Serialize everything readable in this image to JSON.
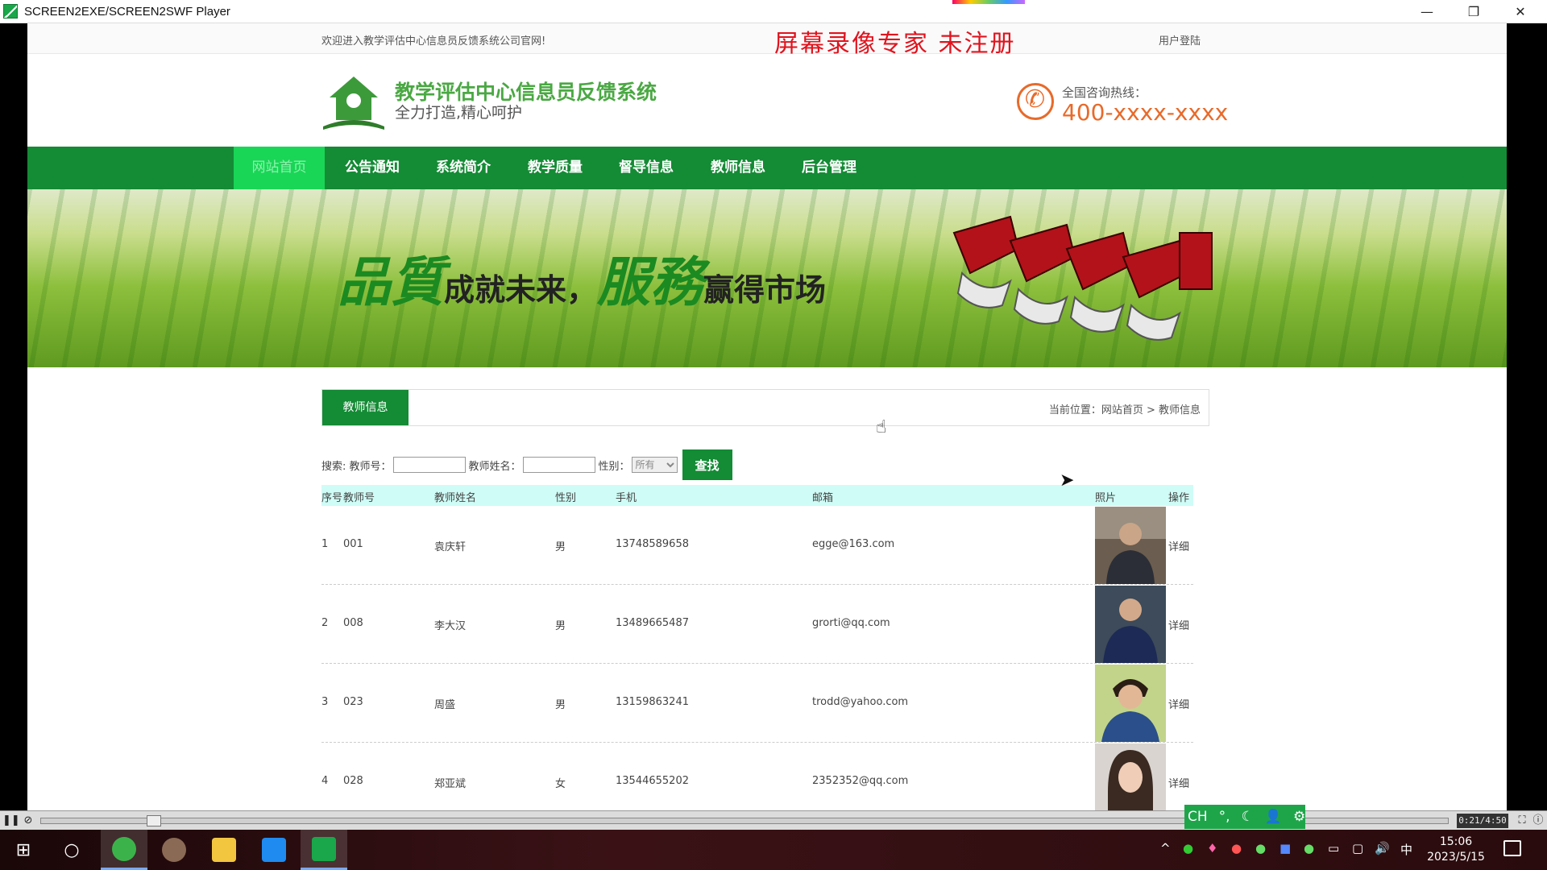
{
  "window": {
    "title": "SCREEN2EXE/SCREEN2SWF Player",
    "min_glyph": "—",
    "max_glyph": "❐",
    "close_glyph": "✕"
  },
  "watermark": "屏幕录像专家  未注册",
  "topbar": {
    "welcome": "欢迎进入教学评估中心信息员反馈系统公司官网!",
    "login": "用户登陆"
  },
  "header": {
    "title": "教学评估中心信息员反馈系统",
    "slogan": "全力打造,精心呵护",
    "hotline_label": "全国咨询热线：",
    "hotline_number": "400-xxxx-xxxx"
  },
  "nav": {
    "items": [
      {
        "label": "网站首页",
        "active": true
      },
      {
        "label": "公告通知"
      },
      {
        "label": "系统简介"
      },
      {
        "label": "教学质量"
      },
      {
        "label": "督导信息"
      },
      {
        "label": "教师信息"
      },
      {
        "label": "后台管理"
      }
    ]
  },
  "banner": {
    "big1": "品質",
    "mid1": "成就未来，",
    "big2": "服務",
    "mid2": "赢得市场"
  },
  "section": {
    "tab": "教师信息",
    "breadcrumb": "当前位置：网站首页 > 教师信息"
  },
  "search": {
    "label": "搜索: 教师号：",
    "name_label": "教师姓名：",
    "gender_label": "性别：",
    "gender_value": "所有",
    "button": "查找"
  },
  "table": {
    "headers": {
      "seq": "序号",
      "no": "教师号",
      "name": "教师姓名",
      "gender": "性别",
      "phone": "手机",
      "email": "邮箱",
      "photo": "照片",
      "op": "操作"
    },
    "rows": [
      {
        "seq": "1",
        "no": "001",
        "name": "袁庆轩",
        "gender": "男",
        "phone": "13748589658",
        "email": "egge@163.com",
        "op": "详细"
      },
      {
        "seq": "2",
        "no": "008",
        "name": "李大汉",
        "gender": "男",
        "phone": "13489665487",
        "email": "grorti@qq.com",
        "op": "详细"
      },
      {
        "seq": "3",
        "no": "023",
        "name": "周盛",
        "gender": "男",
        "phone": "13159863241",
        "email": "trodd@yahoo.com",
        "op": "详细"
      },
      {
        "seq": "4",
        "no": "028",
        "name": "郑亚斌",
        "gender": "女",
        "phone": "13544655202",
        "email": "2352352@qq.com",
        "op": "详细"
      }
    ]
  },
  "player": {
    "time": "0:21/4:50"
  },
  "ime": {
    "lang": "CH",
    "punct": "°,",
    "moon": "☾",
    "user": "👤",
    "gear": "⚙"
  },
  "taskbar": {
    "clock_time": "15:06",
    "clock_date": "2023/5/15",
    "ime_char": "中",
    "caret": "^",
    "volume": "🔊"
  },
  "colors": {
    "nav_green": "#148b35",
    "active_nav": "#19d656",
    "hotline_orange": "#e86a2a",
    "watermark_red": "#e0141e",
    "table_header": "#cffcf6"
  }
}
